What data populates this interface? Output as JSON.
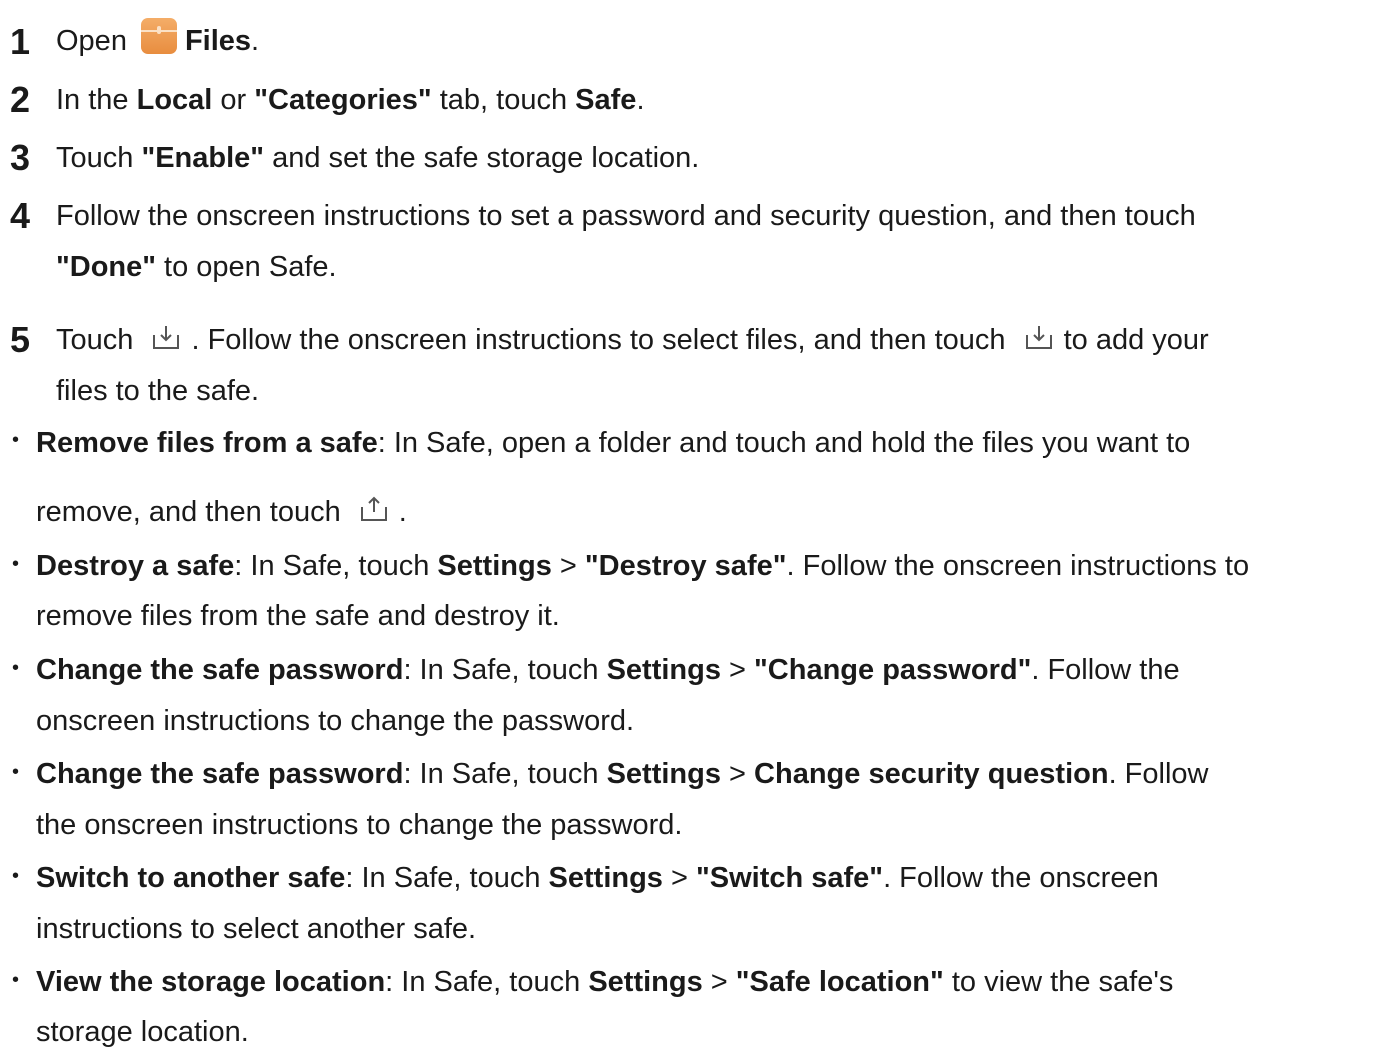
{
  "steps": [
    {
      "num": "1",
      "a": "Open",
      "b": "Files",
      "c": "."
    },
    {
      "num": "2",
      "a": "In the ",
      "b": "Local",
      "c": " or ",
      "d": "\"Categories\"",
      "e": " tab, touch ",
      "f": "Safe",
      "g": "."
    },
    {
      "num": "3",
      "a": "Touch ",
      "b": "\"Enable\"",
      "c": " and set the safe storage location."
    },
    {
      "num": "4",
      "a": "Follow the onscreen instructions to set a password and security question, and then touch",
      "b": "\"Done\"",
      "c": " to open Safe."
    },
    {
      "num": "5",
      "a": "Touch",
      "b": ". Follow the onscreen instructions to select files, and then touch",
      "c": "to add your",
      "d": "files to the safe."
    }
  ],
  "bullets": [
    {
      "title": "Remove files from a safe",
      "text": ": In Safe, open a folder and touch and hold the files you want to",
      "text2": "remove, and then touch",
      "text3": "."
    },
    {
      "title": "Destroy a safe",
      "t1": ": In Safe, touch ",
      "b1": "Settings",
      "t2": " > ",
      "b2": "\"Destroy safe\"",
      "t3": ". Follow the onscreen instructions to",
      "line2": "remove files from the safe and destroy it."
    },
    {
      "title": "Change the safe password",
      "t1": ": In Safe, touch ",
      "b1": "Settings",
      "t2": " > ",
      "b2": "\"Change password\"",
      "t3": ". Follow the",
      "line2": "onscreen instructions to change the password."
    },
    {
      "title": "Change the safe password",
      "t1": ": In Safe, touch ",
      "b1": "Settings",
      "t2": " > ",
      "b2": "Change security question",
      "t3": ". Follow",
      "line2": "the onscreen instructions to change the password."
    },
    {
      "title": "Switch to another safe",
      "t1": ": In Safe, touch ",
      "b1": "Settings",
      "t2": " > ",
      "b2": "\"Switch safe\"",
      "t3": ". Follow the onscreen",
      "line2": "instructions to select another safe."
    },
    {
      "title": "View the storage location",
      "t1": ": In Safe, touch ",
      "b1": "Settings",
      "t2": " > ",
      "b2": "\"Safe location\"",
      "t3": " to view the safe's",
      "line2": "storage location."
    }
  ],
  "icons": {
    "files": "files-app-icon",
    "add": "tray-download-icon",
    "remove": "tray-upload-icon"
  },
  "bullet_char": "•"
}
